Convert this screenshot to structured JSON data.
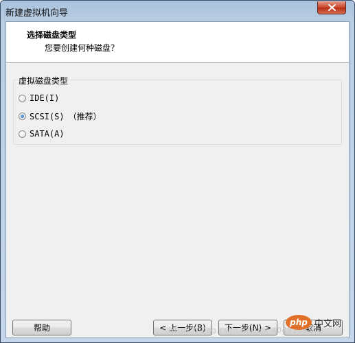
{
  "window": {
    "title": "新建虚拟机向导"
  },
  "header": {
    "title": "选择磁盘类型",
    "subtitle": "您要创建何种磁盘？"
  },
  "disk_type_group": {
    "legend": "虚拟磁盘类型",
    "options": [
      {
        "label": "IDE(I)",
        "note": "",
        "selected": false
      },
      {
        "label": "SCSI(S)",
        "note": "（推荐）",
        "selected": true
      },
      {
        "label": "SATA(A)",
        "note": "",
        "selected": false
      }
    ]
  },
  "buttons": {
    "help": "帮助",
    "back": "< 上一步(B)",
    "next": "下一步(N) >",
    "cancel": "取消"
  },
  "watermark": {
    "text": "https://blog.csdn.net/qq_40481883",
    "logo": "php",
    "site": "中文网"
  },
  "colors": {
    "accent": "#1d5fb0",
    "close_button": "#c7452b",
    "client_bg": "#f0f0f0"
  }
}
